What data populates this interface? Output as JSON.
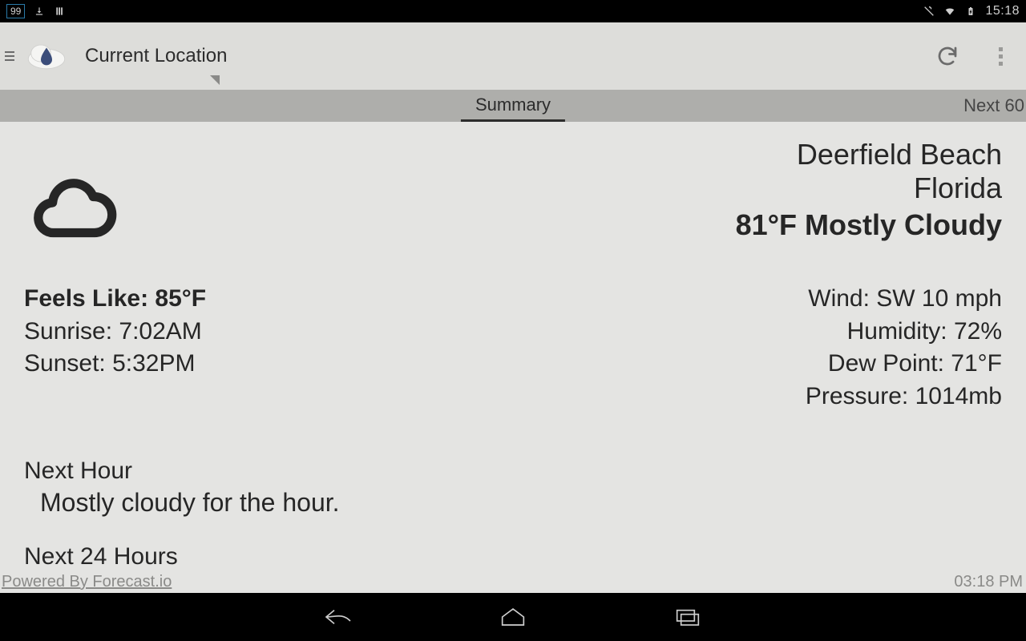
{
  "statusbar": {
    "badge": "99",
    "clock": "15:18"
  },
  "appbar": {
    "title": "Current Location"
  },
  "tabs": {
    "summary": "Summary",
    "next60": "Next 60"
  },
  "location": {
    "city": "Deerfield Beach",
    "state": "Florida",
    "condition_line": "81°F Mostly Cloudy"
  },
  "left_stats": {
    "feels_like": "Feels Like: 85°F",
    "sunrise": "Sunrise: 7:02AM",
    "sunset": "Sunset: 5:32PM"
  },
  "right_stats": {
    "wind": "Wind: SW 10 mph",
    "humidity": "Humidity: 72%",
    "dewpoint": "Dew Point: 71°F",
    "pressure": "Pressure: 1014mb"
  },
  "sections": {
    "next_hour_heading": "Next Hour",
    "next_hour_text": "Mostly cloudy for the hour.",
    "next_24_heading": "Next 24 Hours"
  },
  "footer": {
    "powered_by": "Powered By Forecast.io",
    "timestamp": "03:18 PM"
  }
}
